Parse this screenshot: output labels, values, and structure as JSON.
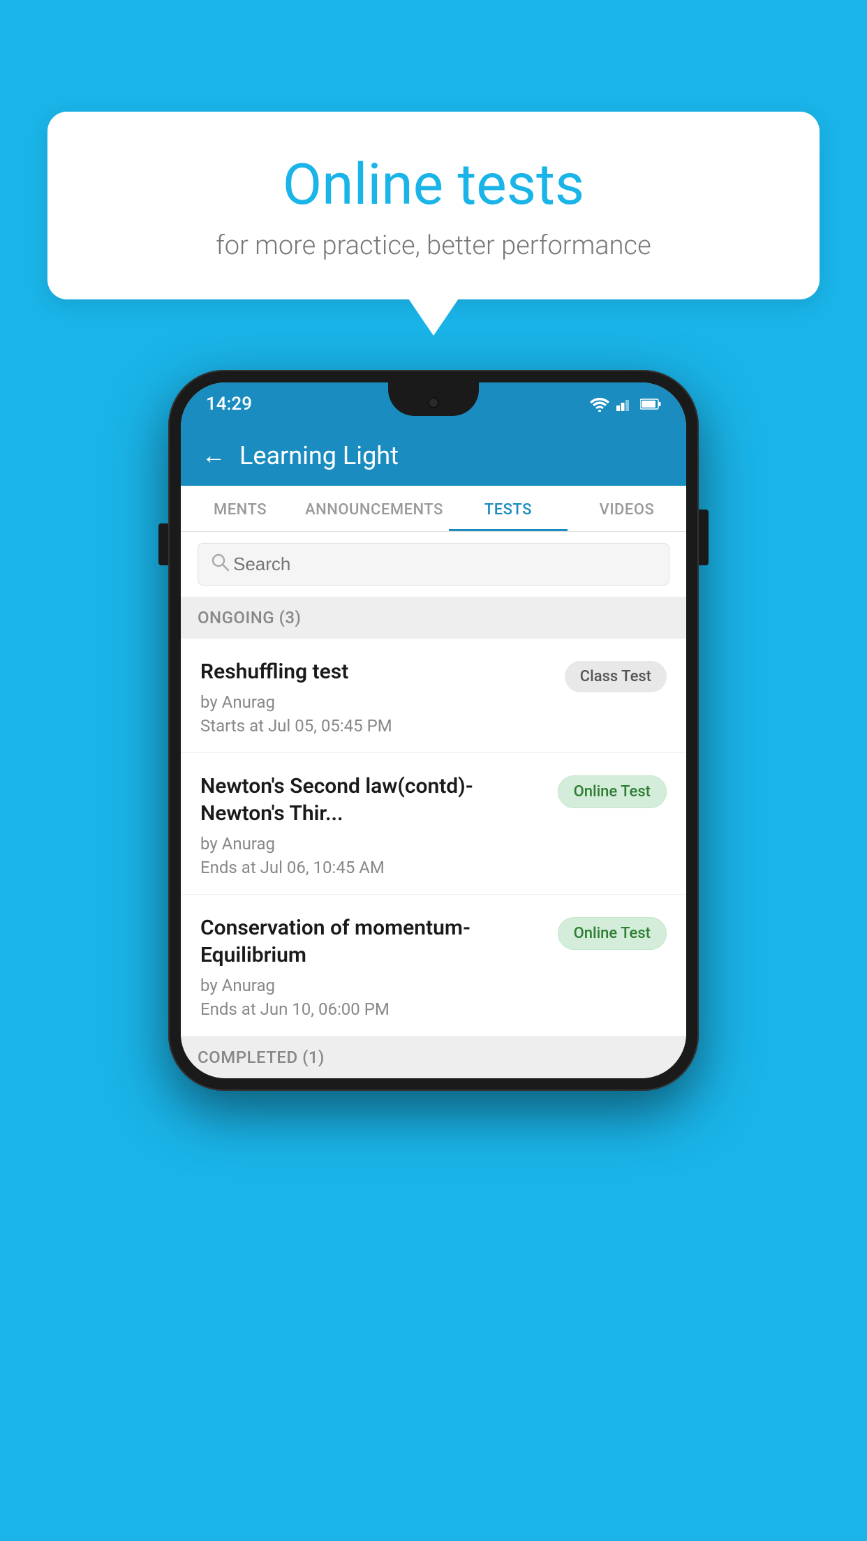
{
  "background_color": "#1ab4e8",
  "speech_bubble": {
    "title": "Online tests",
    "subtitle": "for more practice, better performance"
  },
  "phone": {
    "status_bar": {
      "time": "14:29",
      "icons": [
        "wifi",
        "signal",
        "battery"
      ]
    },
    "header": {
      "back_label": "←",
      "title": "Learning Light"
    },
    "tabs": [
      {
        "label": "MENTS",
        "active": false
      },
      {
        "label": "ANNOUNCEMENTS",
        "active": false
      },
      {
        "label": "TESTS",
        "active": true
      },
      {
        "label": "VIDEOS",
        "active": false
      }
    ],
    "search": {
      "placeholder": "Search"
    },
    "ongoing_section": {
      "label": "ONGOING (3)"
    },
    "tests": [
      {
        "name": "Reshuffling test",
        "author": "by Anurag",
        "time_label": "Starts at",
        "time": "Jul 05, 05:45 PM",
        "badge": "Class Test",
        "badge_type": "class"
      },
      {
        "name": "Newton's Second law(contd)-Newton's Thir...",
        "author": "by Anurag",
        "time_label": "Ends at",
        "time": "Jul 06, 10:45 AM",
        "badge": "Online Test",
        "badge_type": "online"
      },
      {
        "name": "Conservation of momentum-Equilibrium",
        "author": "by Anurag",
        "time_label": "Ends at",
        "time": "Jun 10, 06:00 PM",
        "badge": "Online Test",
        "badge_type": "online"
      }
    ],
    "completed_section": {
      "label": "COMPLETED (1)"
    }
  }
}
